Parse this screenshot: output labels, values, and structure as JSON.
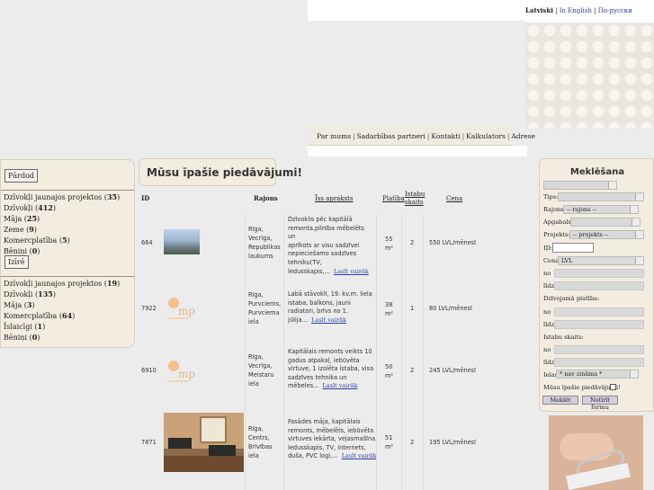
{
  "languages": {
    "current": "Latviski",
    "english": "In English",
    "russian": "По-русски"
  },
  "nav": [
    "Par mums",
    "Sadarbības partneri",
    "Kontakti",
    "Kalkulators",
    "Adrese"
  ],
  "sidebar": {
    "sell_button": "Pārdod",
    "sell_items": [
      {
        "label": "Dzīvokļi jaunajos projektos",
        "count": "35"
      },
      {
        "label": "Dzīvokļi",
        "count": "412"
      },
      {
        "label": "Māja",
        "count": "25"
      },
      {
        "label": "Zeme",
        "count": "9"
      },
      {
        "label": "Komercplatība",
        "count": "5"
      },
      {
        "label": "Bēniņi",
        "count": "0"
      }
    ],
    "rent_button": "Izīrē",
    "rent_items": [
      {
        "label": "Dzīvokļi jaunajos projektos",
        "count": "19"
      },
      {
        "label": "Dzīvokļi",
        "count": "135"
      },
      {
        "label": "Māja",
        "count": "3"
      },
      {
        "label": "Komercplatība",
        "count": "64"
      },
      {
        "label": "Īslaicīgi",
        "count": "1"
      },
      {
        "label": "Bēniņi",
        "count": "0"
      }
    ]
  },
  "main": {
    "title": "Mūsu īpašie piedāvājumi!",
    "columns": {
      "id": "ID",
      "district": "Rajons",
      "desc": "Īss apraksts",
      "area": "Platība",
      "rooms_line1": "Istabu",
      "rooms_line2": "skaits",
      "price": "Cena"
    },
    "read_more": "Lasīt vairāk",
    "listings": [
      {
        "id": "664",
        "district": [
          "Rīga,",
          "Vecrīga,",
          "Republikas",
          "laukums"
        ],
        "desc": [
          "Dzīvoklis pēc kapitālā",
          "remonta,pilnība mēbelēts un",
          "aprīkots ar visu sadzīvei",
          "nepieciešamo sadzīves",
          "tehniku(TV,",
          "ledusskapis,..."
        ],
        "area": "55",
        "unit": "m²",
        "rooms": "2",
        "price": "550 LVL/mēnesī"
      },
      {
        "id": "7922",
        "district": [
          "Rīga,",
          "Purvciems,",
          "Purvciema",
          "iela"
        ],
        "desc": [
          "Labā stāvoklī, 19. kv.m. liela",
          "istaba, balkons, jauni",
          "radiatori, brīvs no 1.",
          "jūlija..."
        ],
        "area": "38",
        "unit": "m²",
        "rooms": "1",
        "price": "80 LVL/mēnesī"
      },
      {
        "id": "6910",
        "district": [
          "Rīga,",
          "Vecrīga,",
          "Meistaru",
          "iela"
        ],
        "desc": [
          "Kapitālais remonts veikts 10",
          "gadus atpakaļ, iebūvēta",
          "virtuve, 1 izolēta istaba, visa",
          "sadzīves tehnika un",
          "mēbeles..."
        ],
        "area": "50",
        "unit": "m²",
        "rooms": "2",
        "price": "245 LVL/mēnesī"
      },
      {
        "id": "7871",
        "district": [
          "Rīga,",
          "Centrs,",
          "Brīvības",
          "iela"
        ],
        "desc": [
          "Fasādes māja, kapitālais",
          "remonts, mēbelēts, iebūvēta",
          "virtuves iekārta, veļasmašīna,",
          "ledusskapis, TV, internets,",
          "duša, PVC logi,..."
        ],
        "area": "51",
        "unit": "m²",
        "rooms": "2",
        "price": "195 LVL/mēnesī"
      }
    ],
    "logo_text": "mp"
  },
  "search": {
    "title": "Meklēšana",
    "type_label": "Tips:",
    "district_label": "Rajons:",
    "district_value": "-- rajons --",
    "area_label": "Apgabals:",
    "project_label": "Projekts:",
    "project_value": "-- projekts --",
    "id_label": "ID:",
    "price_label": "Cena",
    "currency_value": "LVL",
    "from_label": "no",
    "to_label": "līdz",
    "living_area_label": "Dzīvojamā platība:",
    "rooms_label": "Istabu skaits:",
    "floor_label": "Ielas",
    "floor_value": "* nav zināma *",
    "special_label": "Mūsu īpašie piedāvājumi!",
    "search_button": "Meklēt",
    "clear_button": "Notīrīt formu"
  }
}
